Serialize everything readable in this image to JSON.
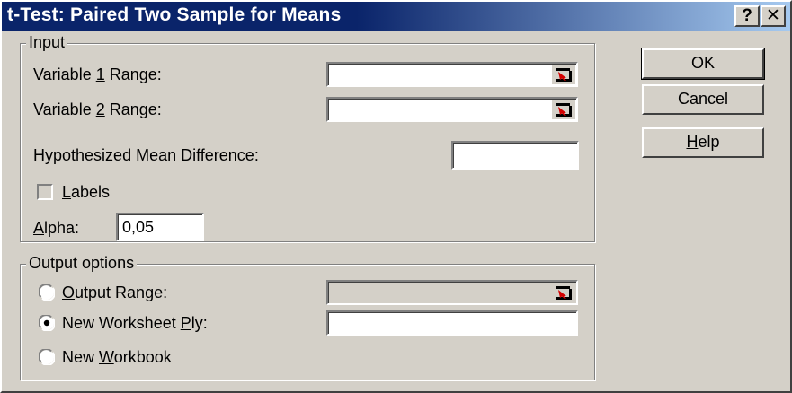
{
  "window": {
    "title": "t-Test: Paired Two Sample for Means",
    "help_glyph": "?",
    "close_glyph": "✕"
  },
  "input_group": {
    "legend": "Input",
    "var1": {
      "pre": "Variable ",
      "key": "1",
      "post": " Range:",
      "value": ""
    },
    "var2": {
      "pre": "Variable ",
      "key": "2",
      "post": " Range:",
      "value": ""
    },
    "hypo": {
      "pre": "Hypot",
      "key": "h",
      "post": "esized Mean Difference:",
      "value": ""
    },
    "labels": {
      "key": "L",
      "post": "abels",
      "checked": false
    },
    "alpha": {
      "key": "A",
      "post": "lpha:",
      "value": "0,05"
    }
  },
  "output_group": {
    "legend": "Output options",
    "output_range": {
      "key": "O",
      "post": "utput Range:",
      "selected": false,
      "value": ""
    },
    "new_worksheet": {
      "pre": "New Worksheet ",
      "key": "P",
      "post": "ly:",
      "selected": true,
      "value": ""
    },
    "new_workbook": {
      "pre": "New ",
      "key": "W",
      "post": "orkbook",
      "selected": false
    }
  },
  "buttons": {
    "ok": "OK",
    "cancel": "Cancel",
    "help": {
      "key": "H",
      "post": "elp"
    }
  },
  "icons": {
    "range_selector": "collapse-dialog-icon",
    "radio_off": "radio-unselected-icon",
    "radio_on": "radio-selected-icon"
  }
}
